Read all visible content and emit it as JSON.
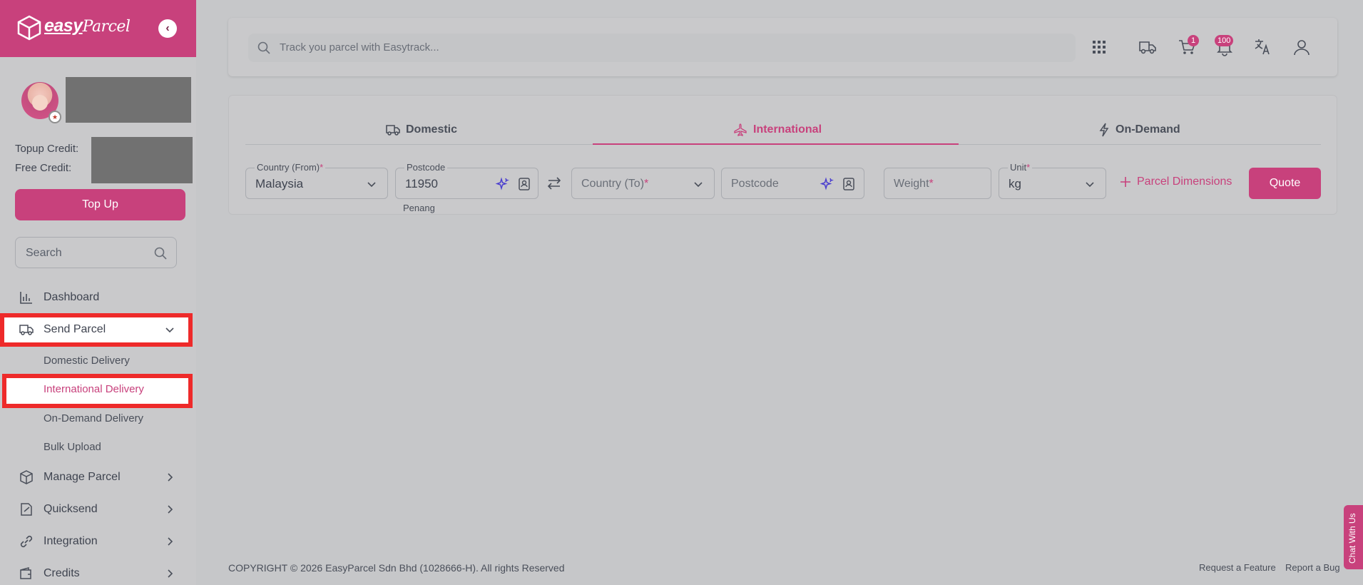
{
  "brand": {
    "name": "easyParcel",
    "logo_text_a": "easy",
    "logo_text_b": "Parcel"
  },
  "sidebar": {
    "topup_credit_label": "Topup Credit:",
    "free_credit_label": "Free Credit:",
    "topup_button": "Top Up",
    "search_placeholder": "Search",
    "nav": {
      "dashboard": "Dashboard",
      "send_parcel": "Send Parcel",
      "domestic_delivery": "Domestic Delivery",
      "international_delivery": "International Delivery",
      "on_demand_delivery": "On-Demand Delivery",
      "bulk_upload": "Bulk Upload",
      "manage_parcel": "Manage Parcel",
      "quicksend": "Quicksend",
      "integration": "Integration",
      "credits": "Credits"
    }
  },
  "topbar": {
    "track_placeholder": "Track you parcel with Easytrack...",
    "cart_badge": "1",
    "notification_badge": "100"
  },
  "tabs": {
    "domestic": "Domestic",
    "international": "International",
    "on_demand": "On-Demand"
  },
  "form": {
    "country_from_label": "Country (From)",
    "country_from_value": "Malaysia",
    "postcode_label": "Postcode",
    "postcode_from_value": "11950",
    "postcode_from_hint": "Penang",
    "country_to_placeholder": "Country (To)",
    "postcode_to_placeholder": "Postcode",
    "weight_placeholder": "Weight",
    "unit_label": "Unit",
    "unit_value": "kg",
    "required_mark": "*",
    "parcel_dimensions": "Parcel Dimensions",
    "quote_button": "Quote"
  },
  "footer": {
    "copyright": "COPYRIGHT © 2026 EasyParcel Sdn Bhd (1028666-H). All rights Reserved",
    "request_feature": "Request a Feature",
    "report_bug": "Report a Bug",
    "chat": "Chat With Us"
  },
  "colors": {
    "brand": "#c8417c",
    "highlight": "#ee2a2a"
  }
}
